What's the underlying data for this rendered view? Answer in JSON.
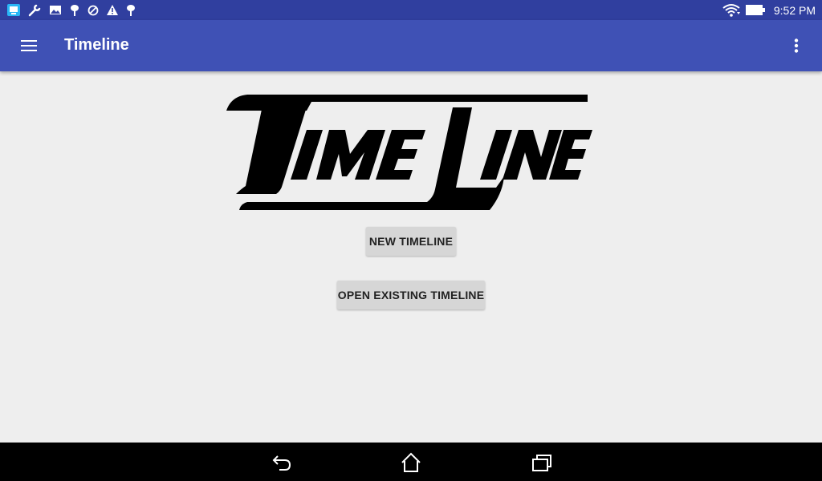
{
  "status_bar": {
    "time": "9:52 PM",
    "left_icons": [
      "screen-icon",
      "wrench-icon",
      "image-icon",
      "android-icon",
      "blocked-icon",
      "warning-icon",
      "android-icon"
    ],
    "right_icons": [
      "wifi-icon",
      "battery-icon"
    ]
  },
  "app_bar": {
    "title": "Timeline",
    "menu_icon": "hamburger-menu-icon",
    "overflow_icon": "more-vert-icon",
    "color": "#3f51b5",
    "status_color": "#303f9f"
  },
  "main": {
    "logo_text": "TimeLine",
    "new_button": "NEW TIMELINE",
    "open_button": "OPEN EXISTING TIMELINE"
  },
  "nav_bar": {
    "icons": [
      "back-icon",
      "home-icon",
      "recents-icon"
    ]
  }
}
